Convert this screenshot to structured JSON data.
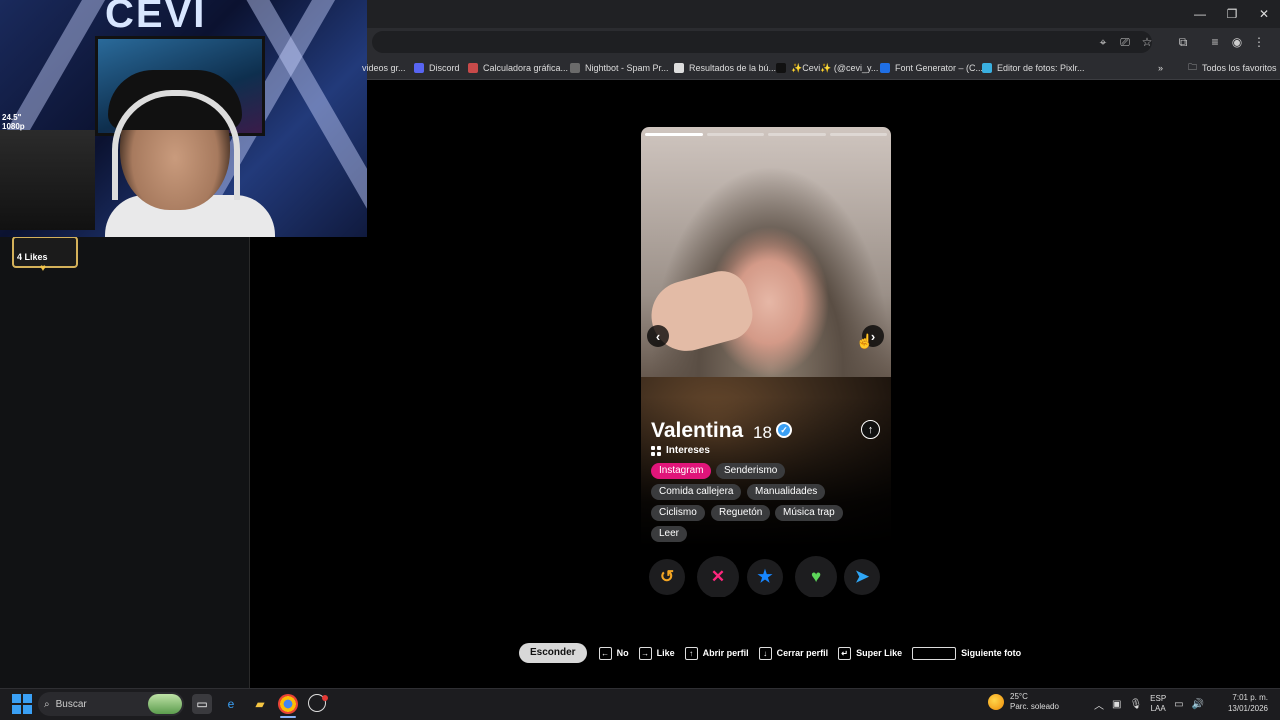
{
  "browser": {
    "bookmarks": [
      {
        "label": "videos gr...",
        "color": "#888"
      },
      {
        "label": "Discord",
        "color": "#5865f2"
      },
      {
        "label": "Calculadora gráfica...",
        "color": "#c84a4a"
      },
      {
        "label": "Nightbot - Spam Pr...",
        "color": "#6b6b6b"
      },
      {
        "label": "Resultados de la bú...",
        "color": "#dddddd"
      },
      {
        "label": "✨Cevi✨ (@cevi_y...",
        "color": "#111111"
      },
      {
        "label": "Font Generator – (C...",
        "color": "#1f6fe5"
      },
      {
        "label": "Editor de fotos: Pixlr...",
        "color": "#3ab0e0"
      }
    ],
    "all_bookmarks": "Todos los favoritos"
  },
  "webcam": {
    "logo": "CEVI",
    "overlay_text": "24.5\"\n1080p"
  },
  "left_panel": {
    "likes_label": "4 Likes"
  },
  "profile": {
    "name": "Valentina",
    "age": "18",
    "interests_label": "Intereses",
    "photo_count": 4,
    "active_photo": 1,
    "tags": [
      {
        "label": "Instagram",
        "active": true
      },
      {
        "label": "Senderismo",
        "active": false
      },
      {
        "label": "Comida callejera",
        "active": false
      },
      {
        "label": "Manualidades",
        "active": false
      },
      {
        "label": "Ciclismo",
        "active": false
      },
      {
        "label": "Reguetón",
        "active": false
      },
      {
        "label": "Música trap",
        "active": false
      },
      {
        "label": "Leer",
        "active": false
      }
    ]
  },
  "actions": [
    {
      "name": "rewind",
      "glyph": "↺",
      "color": "#f5a623"
    },
    {
      "name": "nope",
      "glyph": "✕",
      "color": "#fd267d"
    },
    {
      "name": "super-like",
      "glyph": "★",
      "color": "#1786ff"
    },
    {
      "name": "like",
      "glyph": "♥",
      "color": "#5dd65a"
    },
    {
      "name": "boost",
      "glyph": "➤",
      "color": "#2fa6f5"
    }
  ],
  "shortcuts": {
    "hide": "Esconder",
    "items": [
      {
        "key": "←",
        "label": "No"
      },
      {
        "key": "→",
        "label": "Like"
      },
      {
        "key": "↑",
        "label": "Abrir perfil"
      },
      {
        "key": "↓",
        "label": "Cerrar perfil"
      },
      {
        "key": "↵",
        "label": "Super Like"
      },
      {
        "key": "",
        "label": "Siguiente foto"
      }
    ]
  },
  "taskbar": {
    "search_placeholder": "Buscar",
    "weather_temp": "25°C",
    "weather_desc": "Parc. soleado",
    "lang_1": "ESP",
    "lang_2": "LAA",
    "time": "7:01 p. m.",
    "date": "13/01/2026"
  }
}
